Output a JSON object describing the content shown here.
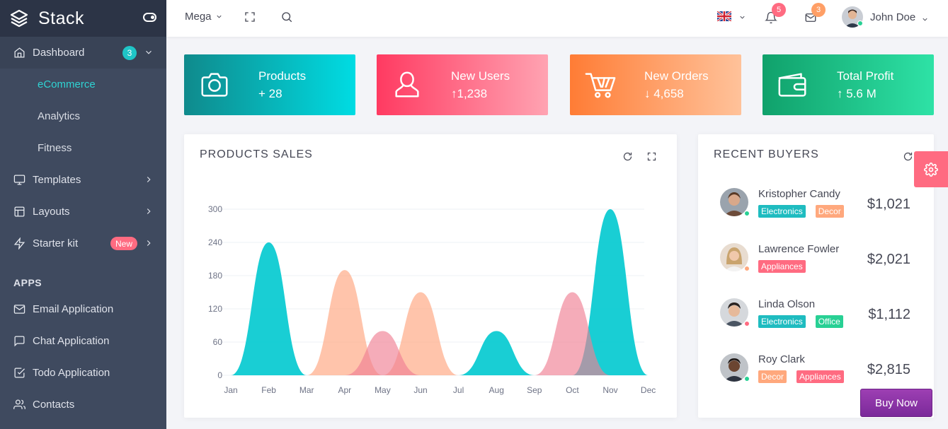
{
  "brand": {
    "name": "Stack"
  },
  "sidebar": {
    "items": [
      {
        "label": "Dashboard",
        "icon": "home-icon",
        "badge": "3"
      },
      {
        "label": "eCommerce"
      },
      {
        "label": "Analytics"
      },
      {
        "label": "Fitness"
      },
      {
        "label": "Templates",
        "icon": "monitor-icon"
      },
      {
        "label": "Layouts",
        "icon": "layout-icon"
      },
      {
        "label": "Starter kit",
        "icon": "zap-icon",
        "badge": "New"
      }
    ],
    "apps_title": "APPS",
    "apps": [
      {
        "label": "Email Application",
        "icon": "mail-icon"
      },
      {
        "label": "Chat Application",
        "icon": "chat-icon"
      },
      {
        "label": "Todo Application",
        "icon": "check-square-icon"
      },
      {
        "label": "Contacts",
        "icon": "users-icon"
      }
    ]
  },
  "header": {
    "mega_label": "Mega",
    "notifications_count": "5",
    "messages_count": "3",
    "user_name": "John Doe",
    "notif_color": "#ff6b81",
    "msg_color": "#ff9f66"
  },
  "stats": [
    {
      "title": "Products",
      "value": "+ 28",
      "icon": "camera-icon",
      "colors": [
        "#0f8a8c",
        "#00dce3"
      ]
    },
    {
      "title": "New Users",
      "value": "↑1,238",
      "icon": "user-icon",
      "colors": [
        "#ff3a61",
        "#ffa3b2"
      ]
    },
    {
      "title": "New Orders",
      "value": "↓ 4,658",
      "icon": "cart-icon",
      "colors": [
        "#ff7c35",
        "#ffc29a"
      ]
    },
    {
      "title": "Total Profit",
      "value": "↑ 5.6 M",
      "icon": "wallet-icon",
      "colors": [
        "#10a16b",
        "#2ee2a6"
      ]
    }
  ],
  "sales_card": {
    "title": "PRODUCTS SALES"
  },
  "chart_data": {
    "type": "area",
    "categories": [
      "Jan",
      "Feb",
      "Mar",
      "Apr",
      "May",
      "Jun",
      "Jul",
      "Aug",
      "Sep",
      "Oct",
      "Nov",
      "Dec"
    ],
    "ylim": [
      0,
      300
    ],
    "yticks": [
      0,
      60,
      120,
      180,
      240,
      300
    ],
    "grid": true,
    "series": [
      {
        "color": "#ffa57e",
        "values": [
          0,
          0,
          0,
          190,
          0,
          150,
          0,
          0,
          0,
          0,
          0,
          0
        ]
      },
      {
        "color": "#00c9cf",
        "values": [
          0,
          240,
          0,
          0,
          0,
          0,
          0,
          80,
          0,
          0,
          300,
          0
        ]
      },
      {
        "color": "#f08093",
        "values": [
          0,
          0,
          0,
          0,
          80,
          0,
          0,
          0,
          0,
          150,
          0,
          0
        ]
      }
    ]
  },
  "buyers_card": {
    "title": "RECENT BUYERS"
  },
  "buyers": [
    {
      "name": "Kristopher Candy",
      "amount": "$1,021",
      "status_color": "#28d094",
      "tags": [
        {
          "label": "Electronics",
          "color": "#1fbcc0"
        },
        {
          "label": "Decor",
          "color": "#ffa87d"
        }
      ]
    },
    {
      "name": "Lawrence Fowler",
      "amount": "$2,021",
      "status_color": "#ffa87d",
      "tags": [
        {
          "label": "Appliances",
          "color": "#ff6b81"
        }
      ]
    },
    {
      "name": "Linda Olson",
      "amount": "$1,112",
      "status_color": "#ff6b81",
      "tags": [
        {
          "label": "Electronics",
          "color": "#1fbcc0"
        },
        {
          "label": "Office",
          "color": "#28d094"
        }
      ]
    },
    {
      "name": "Roy Clark",
      "amount": "$2,815",
      "status_color": "#28d094",
      "tags": [
        {
          "label": "Decor",
          "color": "#ffa87d"
        },
        {
          "label": "Appliances",
          "color": "#ff6b81"
        }
      ]
    }
  ],
  "buy_now_label": "Buy Now"
}
